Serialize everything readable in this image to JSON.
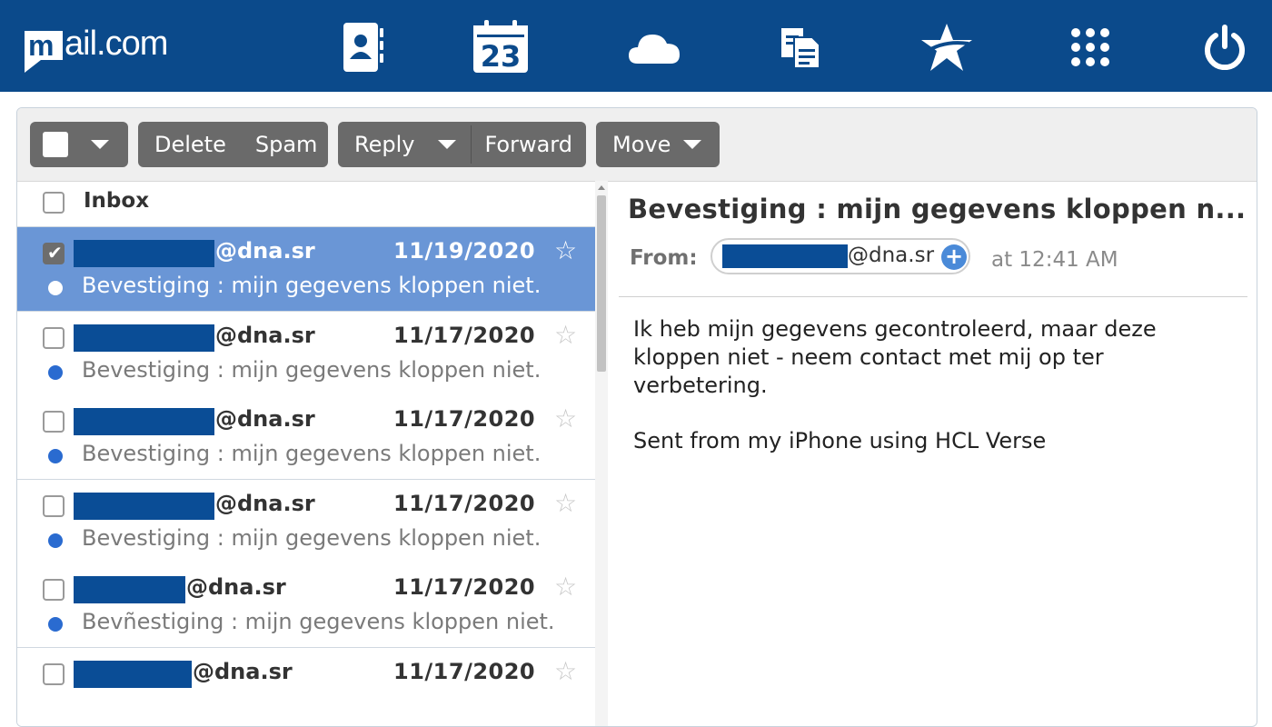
{
  "app": {
    "brand_prefix": "m",
    "brand_text": "ail.com"
  },
  "topnav": [
    {
      "name": "contacts-icon"
    },
    {
      "name": "calendar-icon",
      "label": "23"
    },
    {
      "name": "cloud-icon"
    },
    {
      "name": "documents-icon"
    },
    {
      "name": "star-icon"
    },
    {
      "name": "apps-grid-icon"
    },
    {
      "name": "power-icon"
    }
  ],
  "toolbar": {
    "delete_label": "Delete",
    "spam_label": "Spam",
    "reply_label": "Reply",
    "forward_label": "Forward",
    "move_label": "Move"
  },
  "inbox": {
    "header_label": "Inbox",
    "messages": [
      {
        "sender": "@dna.sr",
        "date": "11/19/2020",
        "subject": "Bevestiging : mijn gegevens kloppen niet.",
        "selected": true
      },
      {
        "sender": "@dna.sr",
        "date": "11/17/2020",
        "subject": "Bevestiging : mijn gegevens kloppen niet.",
        "selected": false
      },
      {
        "sender": "@dna.sr",
        "date": "11/17/2020",
        "subject": "Bevestiging : mijn gegevens kloppen niet.",
        "selected": false
      },
      {
        "sender": "@dna.sr",
        "date": "11/17/2020",
        "subject": "Bevestiging : mijn gegevens kloppen niet.",
        "selected": false
      },
      {
        "sender": "@dna.sr",
        "date": "11/17/2020",
        "subject": "Bevñestiging : mijn gegevens kloppen niet.",
        "selected": false
      },
      {
        "sender": "@dna.sr",
        "date": "11/17/2020",
        "subject": "",
        "selected": false
      }
    ]
  },
  "reading": {
    "title": "Bevestiging : mijn gegevens kloppen n...",
    "from_label": "From:",
    "from_address": "@dna.sr",
    "time": "at 12:41 AM",
    "body_lines": [
      "Ik heb mijn gegevens gecontroleerd, maar deze kloppen niet - neem contact met mij op ter verbetering.",
      "Sent from my iPhone using HCL Verse"
    ]
  },
  "colors": {
    "topbar": "#0b4a8b",
    "selected_row": "#6a96d6",
    "unread_dot": "#2a6bd0",
    "redaction": "#0a4d96"
  }
}
